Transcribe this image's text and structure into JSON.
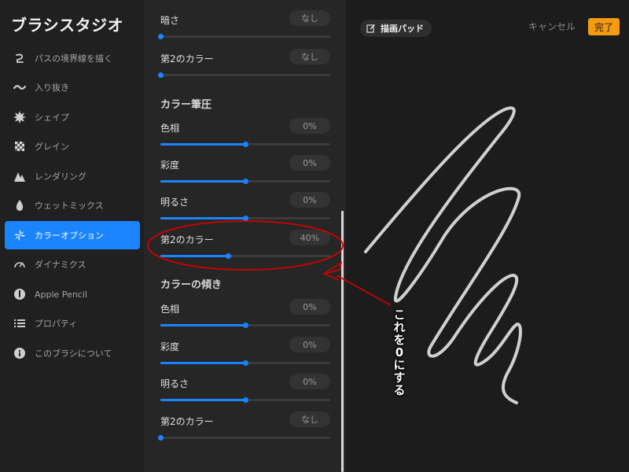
{
  "sidebar": {
    "title": "ブラシスタジオ",
    "items": [
      {
        "label": "パスの境界線を描く",
        "icon": "stroke-path-icon",
        "active": false
      },
      {
        "label": "入り抜き",
        "icon": "taper-icon",
        "active": false
      },
      {
        "label": "シェイプ",
        "icon": "shape-icon",
        "active": false
      },
      {
        "label": "グレイン",
        "icon": "grain-icon",
        "active": false
      },
      {
        "label": "レンダリング",
        "icon": "rendering-icon",
        "active": false
      },
      {
        "label": "ウェットミックス",
        "icon": "wet-mix-icon",
        "active": false
      },
      {
        "label": "カラーオプション",
        "icon": "color-options-icon",
        "active": true
      },
      {
        "label": "ダイナミクス",
        "icon": "dynamics-icon",
        "active": false
      },
      {
        "label": "Apple Pencil",
        "icon": "apple-pencil-icon",
        "active": false
      },
      {
        "label": "プロパティ",
        "icon": "properties-icon",
        "active": false
      },
      {
        "label": "このブラシについて",
        "icon": "info-icon",
        "active": false
      }
    ]
  },
  "panel": {
    "top_rows": [
      {
        "name": "暗さ",
        "value": "なし",
        "level": 0
      },
      {
        "name": "第2のカラー",
        "value": "なし",
        "level": 0
      }
    ],
    "pressure_section": {
      "title": "カラー筆圧",
      "rows": [
        {
          "name": "色相",
          "value": "0%",
          "level": 0.5
        },
        {
          "name": "彩度",
          "value": "0%",
          "level": 0.5
        },
        {
          "name": "明るさ",
          "value": "0%",
          "level": 0.5
        },
        {
          "name": "第2のカラー",
          "value": "40%",
          "level": 0.4
        }
      ]
    },
    "tilt_section": {
      "title": "カラーの傾き",
      "rows": [
        {
          "name": "色相",
          "value": "0%",
          "level": 0.5
        },
        {
          "name": "彩度",
          "value": "0%",
          "level": 0.5
        },
        {
          "name": "明るさ",
          "value": "0%",
          "level": 0.5
        },
        {
          "name": "第2のカラー",
          "value": "なし",
          "level": 0
        }
      ]
    }
  },
  "preview": {
    "drawpad_label": "描画パッド",
    "cancel_label": "キャンセル",
    "done_label": "完了"
  },
  "annotation": {
    "text": "これを0にする",
    "color": "#d40000"
  },
  "colors": {
    "accent": "#1a84ff",
    "done": "#f39c12",
    "sidebar_bg": "#202020",
    "panel_bg": "#262626",
    "canvas_bg": "#1c1c1c"
  }
}
